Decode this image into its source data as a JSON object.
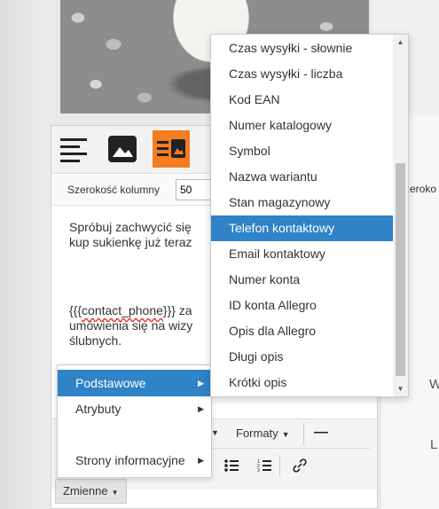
{
  "layout": {
    "active_index": 2,
    "accent": "#f57c20"
  },
  "column_width": {
    "label": "Szerokość kolumny",
    "value": "50"
  },
  "content": {
    "line1": "Spróbuj zachwycić się",
    "line2": "kup sukienkę już teraz",
    "para2_prefix": "{{{",
    "para2_var": "contact_phone",
    "para2_suffix": "}}} za",
    "para2_line2": "umówienia się na wizy",
    "para2_line3": "ślubnych."
  },
  "toolbar": {
    "formats_label": "Formaty",
    "bold_glyph": "—"
  },
  "zmienne_button": "Zmienne",
  "context_menu": {
    "items": [
      "Podstawowe",
      "Atrybuty",
      "",
      "Strony informacyjne"
    ],
    "active_index": 0
  },
  "dropdown": {
    "items": [
      "Czas wysyłki - słownie",
      "Czas wysyłki - liczba",
      "Kod EAN",
      "Numer katalogowy",
      "Symbol",
      "Nazwa wariantu",
      "Stan magazynowy",
      "Telefon kontaktowy",
      "Email kontaktowy",
      "Numer konta",
      "ID konta Allegro",
      "Opis dla Allegro",
      "Długi opis",
      "Krótki opis"
    ],
    "selected_index": 7
  },
  "partials": {
    "szer": "zeroko",
    "w": "W",
    "l": "L"
  },
  "colors": {
    "selection": "#2f83c6"
  }
}
